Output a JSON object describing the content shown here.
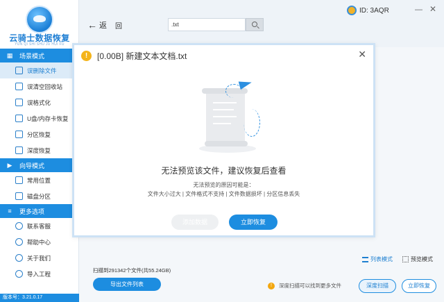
{
  "app": {
    "logo_title": "云骑士数据恢复",
    "logo_subtitle": "YUN QI SHI SHU JU HUI FU",
    "version": "版本号：3.21.0.17"
  },
  "sidebar": {
    "sections": [
      {
        "title": "场景模式",
        "items": [
          {
            "label": "误删除文件",
            "active": true
          },
          {
            "label": "误清空回收站"
          },
          {
            "label": "误格式化"
          },
          {
            "label": "U盘/内存卡恢复"
          },
          {
            "label": "分区恢复"
          },
          {
            "label": "深度恢复"
          }
        ]
      },
      {
        "title": "向导模式",
        "items": [
          {
            "label": "常用位置"
          },
          {
            "label": "磁盘分区"
          }
        ]
      },
      {
        "title": "更多选项",
        "items": [
          {
            "label": "联系客服"
          },
          {
            "label": "帮助中心"
          },
          {
            "label": "关于我们"
          },
          {
            "label": "导入工程"
          }
        ]
      }
    ]
  },
  "topbar": {
    "back_label": "返",
    "back_label2": "回",
    "search_value": ".txt",
    "user_id": "ID: 3AQR",
    "minimize": "—",
    "close": "✕"
  },
  "content": {
    "view_list": "列表模式",
    "view_preview": "预览模式",
    "scan_summary": "扫描到291342个文件(共55.24GB)",
    "export_button": "导出文件列表",
    "deep_tip": "深度扫描可以找到更多文件",
    "deep_scan_button": "深度扫描",
    "recover_now_button": "立即恢复"
  },
  "modal": {
    "title": "[0.00B] 新建文本文档.txt",
    "close": "✕",
    "message": "无法预览该文件，建议恢复后查看",
    "reasons_title": "无法预览的原因可能是：",
    "reasons": "文件大小过大 | 文件格式不支持 | 文件数据损坏 | 分区信息丢失",
    "add_button": "添加数据",
    "recover_button": "立即恢复"
  },
  "colors": {
    "accent": "#1d8de0",
    "warning": "#f4b41a"
  }
}
